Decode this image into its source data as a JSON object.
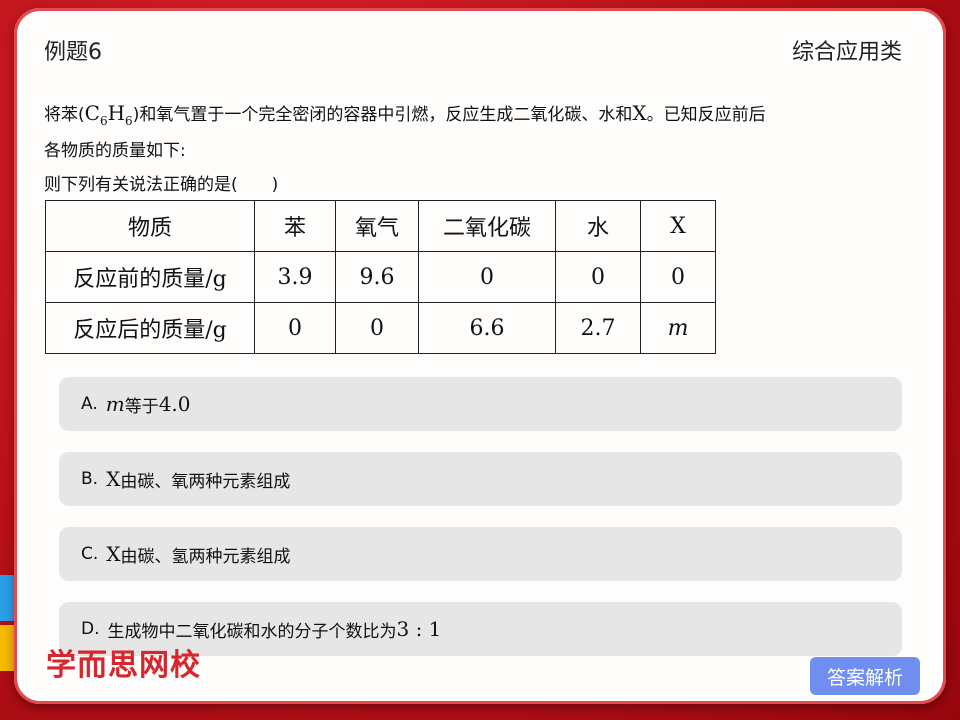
{
  "header": {
    "example_label": "例题6",
    "category": "综合应用类"
  },
  "question": {
    "line1_prefix": "将苯(",
    "formula_c": "C",
    "formula_sub1": "6",
    "formula_h": "H",
    "formula_sub2": "6",
    "line1_mid": ")和氧气置于一个完全密闭的容器中引燃，反应生成二氧化碳、水和",
    "x_symbol": "X",
    "line1_suffix": "。已知反应前后",
    "line2": "各物质的质量如下:",
    "line3": "则下列有关说法正确的是(　　)"
  },
  "table": {
    "headers": [
      "物质",
      "苯",
      "氧气",
      "二氧化碳",
      "水",
      "X"
    ],
    "rows": [
      [
        "反应前的质量/g",
        "3.9",
        "9.6",
        "0",
        "0",
        "0"
      ],
      [
        "反应后的质量/g",
        "0",
        "0",
        "6.6",
        "2.7",
        "m"
      ]
    ]
  },
  "options": [
    {
      "letter": "A.",
      "math": "m",
      "text": "等于",
      "tail": "4.0"
    },
    {
      "letter": "B.",
      "math": "X",
      "text": "由碳、氧两种元素组成",
      "tail": ""
    },
    {
      "letter": "C.",
      "math": "X",
      "text": "由碳、氢两种元素组成",
      "tail": ""
    },
    {
      "letter": "D.",
      "math": "",
      "text": "生成物中二氧化碳和水的分子个数比为",
      "tail": "3 : 1"
    }
  ],
  "branding": {
    "logo_text": "学而思网校"
  },
  "buttons": {
    "answer_label": "答案解析"
  },
  "colors": {
    "frame_red": "#b71018",
    "option_bg": "#e6e6e6",
    "answer_button": "#6f8ef0",
    "logo_red": "#d8262e"
  }
}
